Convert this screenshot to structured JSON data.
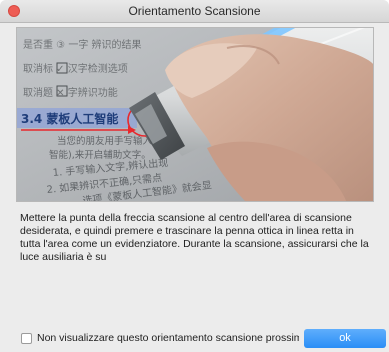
{
  "window": {
    "title": "Orientamento Scansione"
  },
  "illustration": {
    "heading_text": "3.4 蒙板人工智能",
    "lines": [
      "当您的朋友用手写输入,",
      "智能),来开启辅助文字。",
      "1. 手写输入文字,辨认出现",
      "2. 如果辨识不正确,只需点",
      "选项《蒙板人工智能》就会显"
    ],
    "top_lines": [
      "是否重 ③ 一字 辨识的结果",
      "取消标 ✓ 汉字检测选项",
      "取消题 ✕ 字辨识功能"
    ]
  },
  "body": {
    "description": "Mettere la punta della freccia scansione al centro dell'area di scansione desiderata, e quindi premere e trascinare la penna ottica in linea retta in tutta l'area come un evidenziatore. Durante la scansione, assicurarsi che la luce ausiliaria è su"
  },
  "footer": {
    "checkbox_label": "Non visualizzare questo orientamento scansione prossima volta",
    "checkbox_checked": false,
    "ok_label": "ok"
  },
  "colors": {
    "accent": "#2a8ef6",
    "arrow": "#e8282d",
    "close": "#ee5d55"
  }
}
